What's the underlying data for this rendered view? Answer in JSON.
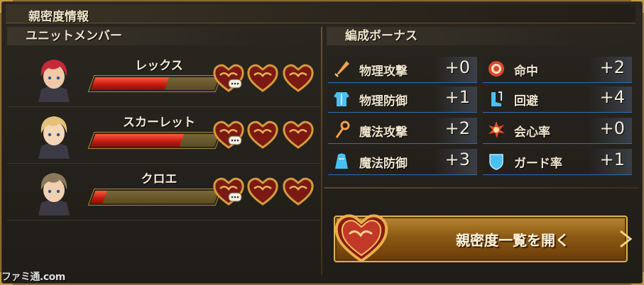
{
  "title": "親密度情報",
  "members_section": {
    "title": "ユニットメンバー",
    "members": [
      {
        "name": "レックス",
        "affinity_fill": 0.6,
        "hair": "#c8283a",
        "skin": "#f2c9a8"
      },
      {
        "name": "スカーレット",
        "affinity_fill": 0.72,
        "hair": "#e6c07a",
        "skin": "#f6d6b8"
      },
      {
        "name": "クロエ",
        "affinity_fill": 0.1,
        "hair": "#8a7a5a",
        "skin": "#f0d0b0"
      }
    ]
  },
  "bonus_section": {
    "title": "編成ボーナス",
    "bonuses": [
      {
        "label": "物理攻撃",
        "value": "+0",
        "icon": "sword-icon"
      },
      {
        "label": "命中",
        "value": "+2",
        "icon": "target-icon"
      },
      {
        "label": "物理防御",
        "value": "+1",
        "icon": "armor-icon"
      },
      {
        "label": "回避",
        "value": "+4",
        "icon": "boots-icon"
      },
      {
        "label": "魔法攻撃",
        "value": "+2",
        "icon": "staff-icon"
      },
      {
        "label": "会心率",
        "value": "+0",
        "icon": "critical-burst-icon"
      },
      {
        "label": "魔法防御",
        "value": "+3",
        "icon": "robe-icon"
      },
      {
        "label": "ガード率",
        "value": "+1",
        "icon": "shield-icon"
      }
    ]
  },
  "open_button": {
    "label": "親密度一覧を開く"
  },
  "watermark": "ファミ通.com",
  "colors": {
    "gold": "#c49a48",
    "gauge_red": "#c61d12",
    "bonus_line": "#2d6fb1"
  }
}
